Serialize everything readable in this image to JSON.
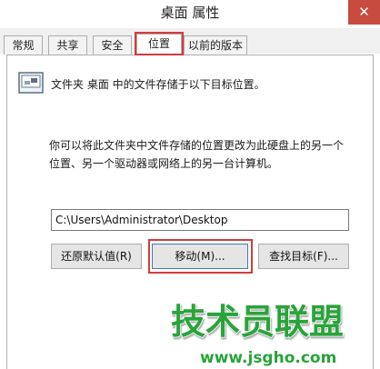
{
  "window": {
    "title": "桌面 属性",
    "close_glyph": "✕"
  },
  "tabs": [
    {
      "label": "常规"
    },
    {
      "label": "共享"
    },
    {
      "label": "安全"
    },
    {
      "label": "位置",
      "active": true
    },
    {
      "label": "以前的版本"
    }
  ],
  "location": {
    "heading": "文件夹 桌面 中的文件存储于以下目标位置。",
    "description": "你可以将此文件夹中文件存储的位置更改为此硬盘上的另一个\n位置、另一个驱动器或网络上的另一台计算机。",
    "path_value": "C:\\Users\\Administrator\\Desktop",
    "restore_button": "还原默认值(R)",
    "move_button": "移动(M)...",
    "find_button": "查找目标(F)..."
  },
  "watermark": {
    "text": "技术员联盟",
    "url": "www.jsgho.com"
  },
  "icons": {
    "folder": "desktop-folder-icon",
    "close": "close-icon"
  },
  "colors": {
    "highlight": "#d63b3b",
    "close_bg": "#c74b3f",
    "watermark": "#29a33a"
  }
}
